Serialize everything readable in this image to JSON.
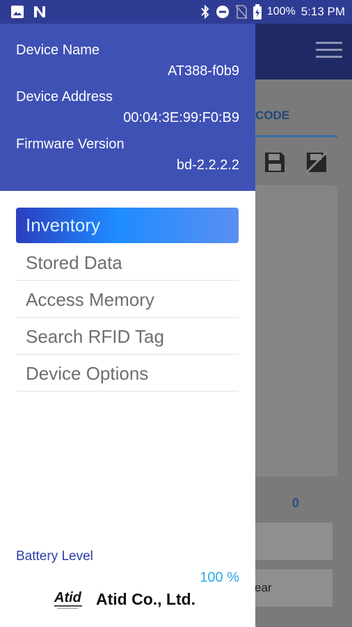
{
  "status_bar": {
    "battery": "100%",
    "time": "5:13 PM",
    "icons": [
      "image-icon",
      "n-icon",
      "bluetooth-icon",
      "do-not-disturb-icon",
      "no-sim-icon",
      "battery-icon"
    ]
  },
  "background": {
    "tab_label": "CODE",
    "count": "0",
    "button2_label": "ear"
  },
  "drawer": {
    "device_name_label": "Device Name",
    "device_name_value": "AT388-f0b9",
    "device_address_label": "Device Address",
    "device_address_value": "00:04:3E:99:F0:B9",
    "firmware_label": "Firmware Version",
    "firmware_value": "bd-2.2.2.2",
    "menu": [
      "Inventory",
      "Stored Data",
      "Access Memory",
      "Search RFID Tag",
      "Device Options"
    ],
    "battery_label": "Battery Level",
    "battery_value": "100 %",
    "brand_logo_text": "Atid",
    "brand_name": "Atid Co., Ltd."
  },
  "colors": {
    "status_bar": "#2f3c94",
    "drawer_header": "#3f51b5",
    "accent": "#1e8cff",
    "battery_value": "#2aa9e8"
  }
}
